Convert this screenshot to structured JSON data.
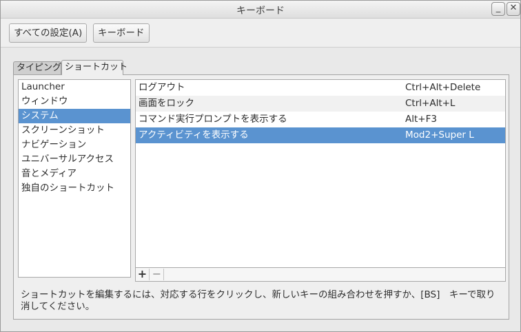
{
  "window": {
    "title": "キーボード",
    "minimize_glyph": "_",
    "close_glyph": "✕"
  },
  "toolbar": {
    "all_settings_label": "すべての設定(A)",
    "keyboard_label": "キーボード"
  },
  "tabs": [
    {
      "label": "タイピング"
    },
    {
      "label": "ショートカット"
    }
  ],
  "categories": [
    {
      "label": "Launcher"
    },
    {
      "label": "ウィンドウ"
    },
    {
      "label": "システム"
    },
    {
      "label": "スクリーンショット"
    },
    {
      "label": "ナビゲーション"
    },
    {
      "label": "ユニバーサルアクセス"
    },
    {
      "label": "音とメディア"
    },
    {
      "label": "独自のショートカット"
    }
  ],
  "shortcuts": [
    {
      "name": "ログアウト",
      "keys": "Ctrl+Alt+Delete"
    },
    {
      "name": "画面をロック",
      "keys": "Ctrl+Alt+L"
    },
    {
      "name": "コマンド実行プロンプトを表示する",
      "keys": "Alt+F3"
    },
    {
      "name": "アクティビティを表示する",
      "keys": "Mod2+Super L"
    }
  ],
  "tools": {
    "add_glyph": "+",
    "remove_glyph": "−"
  },
  "help_text": "ショートカットを編集するには、対応する行をクリックし、新しいキーの組み合わせを押すか、[BS]　キーで取り消してください。",
  "colors": {
    "selection": "#5a93d0"
  }
}
